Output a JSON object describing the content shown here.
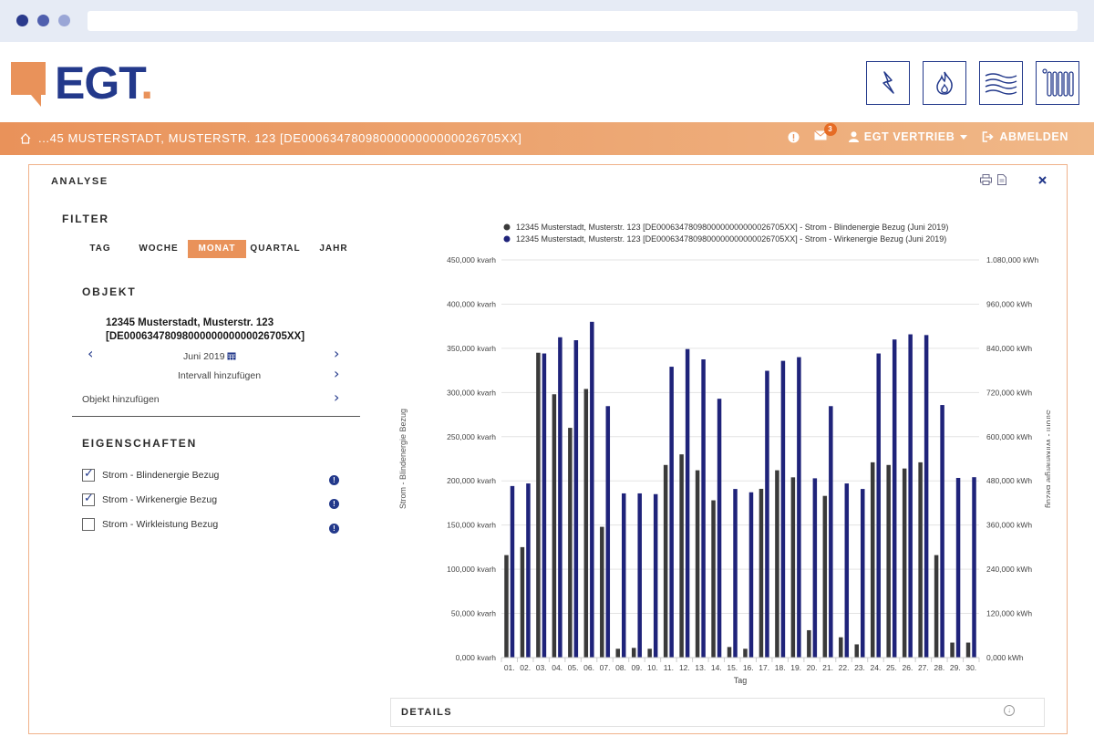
{
  "header": {
    "logo_text": "EGT",
    "mode_buttons": [
      "strom-icon",
      "gas-icon",
      "waerme-icon",
      "heizung-icon"
    ]
  },
  "nav": {
    "address": "...45 MUSTERSTADT, MUSTERSTR. 123 [DE0006347809800000000000026705XX]",
    "message_count": "3",
    "user": "EGT VERTRIEB",
    "logout": "ABMELDEN"
  },
  "panel": {
    "title": "ANALYSE",
    "filter_heading": "FILTER",
    "period_tabs": [
      "TAG",
      "WOCHE",
      "MONAT",
      "QUARTAL",
      "JAHR"
    ],
    "active_tab": "MONAT",
    "objekt_heading": "OBJEKT",
    "object_line1": "12345 Musterstadt, Musterstr. 123",
    "object_line2": "[DE0006347809800000000000026705XX]",
    "month": "Juni 2019",
    "add_interval": "Intervall hinzufügen",
    "add_object": "Objekt hinzufügen",
    "properties_heading": "EIGENSCHAFTEN",
    "properties": [
      {
        "label": "Strom - Blindenergie Bezug",
        "checked": true
      },
      {
        "label": "Strom - Wirkenergie Bezug",
        "checked": true
      },
      {
        "label": "Strom - Wirkleistung Bezug",
        "checked": false
      }
    ],
    "details_label": "DETAILS"
  },
  "colors": {
    "orange": "#e9925a",
    "navy": "#23398b",
    "series_blind": "#3a3a3a",
    "series_wirk": "#1f237a"
  },
  "chart_data": {
    "type": "bar",
    "xlabel": "Tag",
    "ylabel_left": "Strom - Blindenergie Bezug",
    "ylabel_right": "Strom - Wirkenergie Bezug",
    "ylim_left": [
      0,
      450000
    ],
    "ylim_right": [
      0,
      1080000
    ],
    "yticks_left": [
      "0,000 kvarh",
      "50,000 kvarh",
      "100,000 kvarh",
      "150,000 kvarh",
      "200,000 kvarh",
      "250,000 kvarh",
      "300,000 kvarh",
      "350,000 kvarh",
      "400,000 kvarh",
      "450,000 kvarh"
    ],
    "yticks_right": [
      "0,000 kWh",
      "120,000 kWh",
      "240,000 kWh",
      "360,000 kWh",
      "480,000 kWh",
      "600,000 kWh",
      "720,000 kWh",
      "840,000 kWh",
      "960,000 kWh",
      "1.080,000 kWh"
    ],
    "legend_position": "top",
    "categories": [
      "01.",
      "02.",
      "03.",
      "04.",
      "05.",
      "06.",
      "07.",
      "08.",
      "09.",
      "10.",
      "11.",
      "12.",
      "13.",
      "14.",
      "15.",
      "16.",
      "17.",
      "18.",
      "19.",
      "20.",
      "21.",
      "22.",
      "23.",
      "24.",
      "25.",
      "26.",
      "27.",
      "28.",
      "29.",
      "30."
    ],
    "series": [
      {
        "name": "12345 Musterstadt, Musterstr. 123 [DE0006347809800000000000026705XX] - Strom - Blindenergie Bezug (Juni 2019)",
        "axis": "left",
        "values": [
          116000,
          125000,
          345000,
          298000,
          260000,
          304000,
          148000,
          10000,
          11000,
          10000,
          218000,
          230000,
          212000,
          178000,
          12000,
          10000,
          191000,
          212000,
          204000,
          31000,
          183000,
          23000,
          15000,
          221000,
          218000,
          214000,
          221000,
          116000,
          17000,
          17000
        ]
      },
      {
        "name": "12345 Musterstadt, Musterstr. 123 [DE0006347809800000000000026705XX] - Strom - Wirkenergie Bezug (Juni 2019)",
        "axis": "right",
        "values": [
          466000,
          473000,
          826000,
          870000,
          862000,
          912000,
          683000,
          446000,
          446000,
          444000,
          790000,
          838000,
          810000,
          703000,
          458000,
          449000,
          779000,
          806000,
          816000,
          487000,
          683000,
          473000,
          458000,
          826000,
          864000,
          878000,
          876000,
          686000,
          488000,
          490000
        ]
      }
    ]
  }
}
